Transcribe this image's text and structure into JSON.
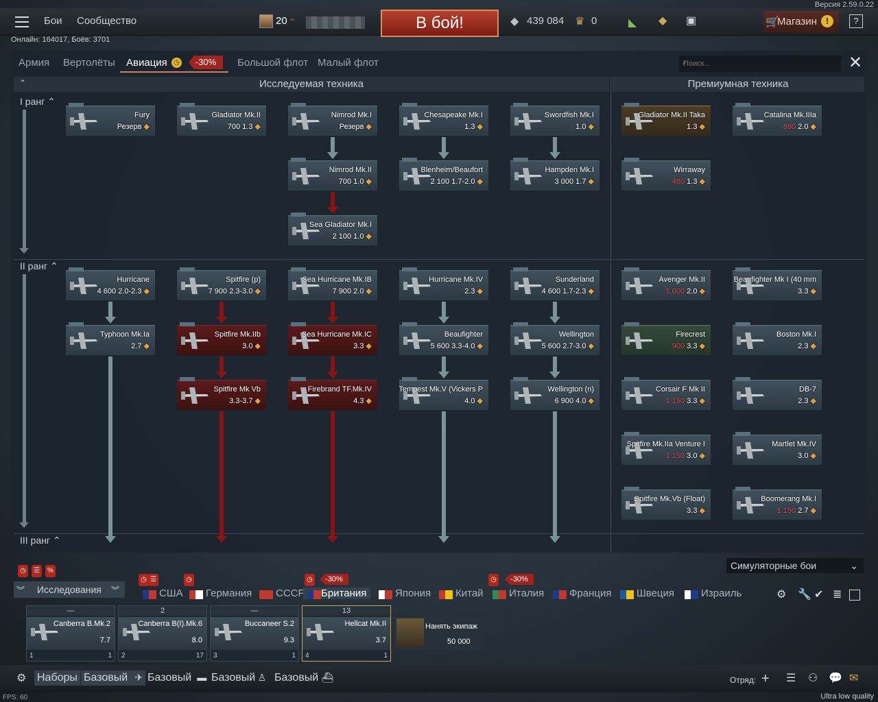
{
  "app": {
    "version": "Версия 2.59.0.22",
    "online": "Онлайн: 164017, Боёв: 3701",
    "fps": "FPS: 60",
    "quality": "Ultra low quality"
  },
  "topbar": {
    "menu": [
      "Бои",
      "Сообщество"
    ],
    "level": "20",
    "battle_button": "В бой!",
    "silver": "439 084",
    "gold": "0",
    "shop": "Магазин"
  },
  "tabs": [
    {
      "label": "Армия"
    },
    {
      "label": "Вертолёты"
    },
    {
      "label": "Авиация",
      "discount": "-30%"
    },
    {
      "label": "Большой флот"
    },
    {
      "label": "Малый флот"
    }
  ],
  "search_placeholder": "Поиск...",
  "headers": {
    "research": "Исследуемая техника",
    "premium": "Премиумная техника"
  },
  "ranks": [
    "I ранг",
    "II ранг",
    "III ранг"
  ],
  "research_tree": [
    {
      "name": "Fury",
      "stats": "Резерв",
      "br_icon": "●",
      "style": "normal"
    },
    {
      "name": "Gladiator Mk.II",
      "stats": "700",
      "br": "1.3",
      "style": "normal"
    },
    {
      "name": "Nimrod Mk.I",
      "stats": "Резерв",
      "style": "normal"
    },
    {
      "name": "Chesapeake Mk.I",
      "stats": "",
      "br": "1.3",
      "style": "normal"
    },
    {
      "name": "Swordfish Mk.I",
      "stats": "",
      "br": "1.0",
      "style": "normal"
    },
    {
      "name": "Nimrod Mk.II",
      "stats": "700",
      "br": "1.0",
      "style": "normal"
    },
    {
      "name": "Blenheim/Beaufort",
      "stats": "2 100",
      "br": "1.7-2.0",
      "style": "normal"
    },
    {
      "name": "Hampden Mk.I",
      "stats": "3 000",
      "br": "1.7",
      "style": "normal"
    },
    {
      "name": "Sea Gladiator Mk.I",
      "stats": "2 100",
      "br": "1.0",
      "style": "normal"
    },
    {
      "name": "Hurricane",
      "stats": "4 600",
      "br": "2.0-2.3",
      "style": "normal"
    },
    {
      "name": "Spitfire (p)",
      "stats": "7 900",
      "br": "2.3-3.0",
      "style": "normal"
    },
    {
      "name": "Sea Hurricane Mk.IB",
      "stats": "7 900",
      "br": "2.0",
      "style": "normal"
    },
    {
      "name": "Hurricane Mk.IV",
      "stats": "",
      "br": "2.3",
      "style": "normal"
    },
    {
      "name": "Sunderland",
      "stats": "4 600",
      "br": "1.7-2.3",
      "style": "normal"
    },
    {
      "name": "Typhoon Mk.Ia",
      "stats": "",
      "br": "2.7",
      "style": "normal"
    },
    {
      "name": "Spitfire Mk.IIb",
      "stats": "",
      "br": "3.0",
      "style": "red"
    },
    {
      "name": "Sea Hurricane Mk.IC",
      "stats": "",
      "br": "3.3",
      "style": "red"
    },
    {
      "name": "Beaufighter",
      "stats": "5 600",
      "br": "3.3-4.0",
      "style": "normal"
    },
    {
      "name": "Wellington",
      "stats": "5 600",
      "br": "2.7-3.0",
      "style": "normal"
    },
    {
      "name": "Spitfire Mk Vb",
      "stats": "",
      "br": "3.3-3.7",
      "style": "red"
    },
    {
      "name": "Firebrand TF.Mk.IV",
      "stats": "",
      "br": "4.3",
      "style": "red"
    },
    {
      "name": "Tempest Mk.V (Vickers P",
      "stats": "",
      "br": "4.0",
      "style": "normal"
    },
    {
      "name": "Wellington (n)",
      "stats": "6 900",
      "br": "4.0",
      "style": "normal"
    }
  ],
  "premium_tree": [
    {
      "name": "Gladiator Mk.II Taka",
      "stats": "",
      "br": "1.3",
      "style": "gold"
    },
    {
      "name": "Catalina Mk.IIIa",
      "stats": "880",
      "br": "2.0",
      "style": "normal"
    },
    {
      "name": "Wirraway",
      "stats": "480",
      "br": "1.3",
      "style": "normal"
    },
    {
      "name": "Avenger Mk.II",
      "stats": "1 000",
      "br": "2.0",
      "style": "normal"
    },
    {
      "name": "Beaufighter Mk I (40 mm",
      "stats": "",
      "br": "3.3",
      "style": "normal"
    },
    {
      "name": "Firecrest",
      "stats": "900",
      "br": "3.3",
      "style": "green"
    },
    {
      "name": "Boston Mk.I",
      "stats": "",
      "br": "2.3",
      "style": "normal"
    },
    {
      "name": "Corsair F Mk II",
      "stats": "1 150",
      "br": "3.3",
      "style": "normal"
    },
    {
      "name": "DB-7",
      "stats": "",
      "br": "2.3",
      "style": "normal"
    },
    {
      "name": "Spitfire Mk.IIa Venture I",
      "stats": "1 150",
      "br": "3.0",
      "style": "normal"
    },
    {
      "name": "Martlet Mk.IV",
      "stats": "",
      "br": "3.0",
      "style": "normal"
    },
    {
      "name": "Spitfire Mk.Vb (Float)",
      "stats": "",
      "br": "3.3",
      "style": "normal"
    },
    {
      "name": "Boomerang Mk.I",
      "stats": "1 150",
      "br": "2.7",
      "style": "normal"
    }
  ],
  "game_mode": "Симуляторные бои",
  "research_btn": "Исследования",
  "nations": [
    {
      "name": "США",
      "colors": [
        "#1b3a8a",
        "#c0392b"
      ]
    },
    {
      "name": "Германия",
      "colors": [
        "#c0392b",
        "#ffffff"
      ]
    },
    {
      "name": "СССР",
      "colors": [
        "#c0392b",
        "#c0392b"
      ]
    },
    {
      "name": "Британия",
      "colors": [
        "#1b3a8a",
        "#c0392b"
      ],
      "active": true,
      "discount": "-30%"
    },
    {
      "name": "Япония",
      "colors": [
        "#ffffff",
        "#c0392b"
      ]
    },
    {
      "name": "Китай",
      "colors": [
        "#c0392b",
        "#f1c40f"
      ]
    },
    {
      "name": "Италия",
      "colors": [
        "#2e8b57",
        "#c0392b"
      ],
      "discount": "-30%"
    },
    {
      "name": "Франция",
      "colors": [
        "#1b3a8a",
        "#c0392b"
      ]
    },
    {
      "name": "Швеция",
      "colors": [
        "#1b5aa0",
        "#f1c40f"
      ]
    },
    {
      "name": "Израиль",
      "colors": [
        "#ffffff",
        "#1b3a8a"
      ]
    }
  ],
  "crews": [
    {
      "slot": "—",
      "name": "Canberra B.Mk.2",
      "br": "7.7",
      "crew": "1",
      "rp": "1"
    },
    {
      "slot": "2",
      "name": "Canberra B(I).Mk.6",
      "br": "8.0",
      "crew": "2",
      "rp": "17"
    },
    {
      "slot": "—",
      "name": "Buccaneer S.2",
      "br": "9.3",
      "crew": "3",
      "rp": "1"
    },
    {
      "slot": "13",
      "name": "Hellcat Mk.II",
      "br": "3.7",
      "crew": "4",
      "rp": "1"
    }
  ],
  "hire": {
    "label": "Нанять экипаж",
    "cost": "50 000"
  },
  "bottombar": {
    "presets": "Наборы",
    "items": [
      "Базовый",
      "Базовый",
      "Базовый",
      "Базовый"
    ],
    "squad": "Отряд:"
  }
}
